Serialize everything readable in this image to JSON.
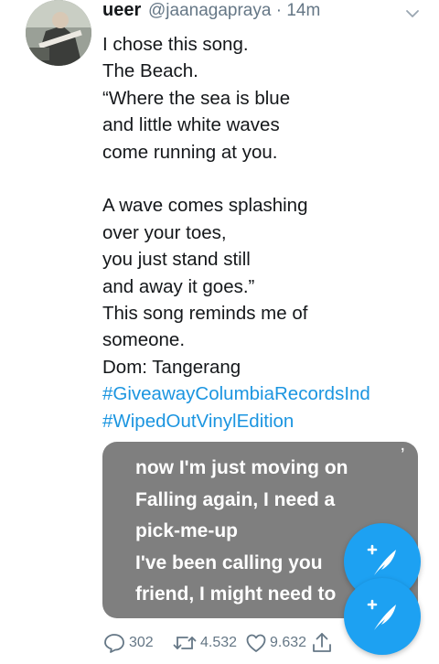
{
  "tweet": {
    "display_name": "ueer",
    "handle": "@jaanagapraya",
    "separator": "·",
    "time": "14m",
    "lines": [
      "I chose this song.",
      "The Beach.",
      "“Where the sea is blue",
      "and little white waves",
      "come running at you.",
      "",
      "A wave comes splashing",
      "over your toes,",
      "you just stand still",
      "and away it goes.”",
      "This song reminds me of",
      "someone.",
      "Dom: Tangerang"
    ],
    "hashtags": [
      "#GiveawayColumbiaRecordsInd",
      "#WipedOutVinylEdition"
    ]
  },
  "media": {
    "top_fragment": ",",
    "lyrics": [
      "now I'm just moving on",
      "Falling again, I need a",
      "pick-me-up",
      "I've been calling you",
      "friend, I might need to"
    ]
  },
  "actions": {
    "reply_count": "302",
    "retweet_count": "4.532",
    "like_count": "9.632"
  },
  "colors": {
    "accent": "#1da1f2",
    "hashtag": "#1b95e0",
    "muted": "#657786",
    "media_bg": "#7f7f7f"
  },
  "icons": [
    "chevron-down-icon",
    "reply-icon",
    "retweet-icon",
    "like-icon",
    "share-icon",
    "compose-tweet-icon"
  ]
}
